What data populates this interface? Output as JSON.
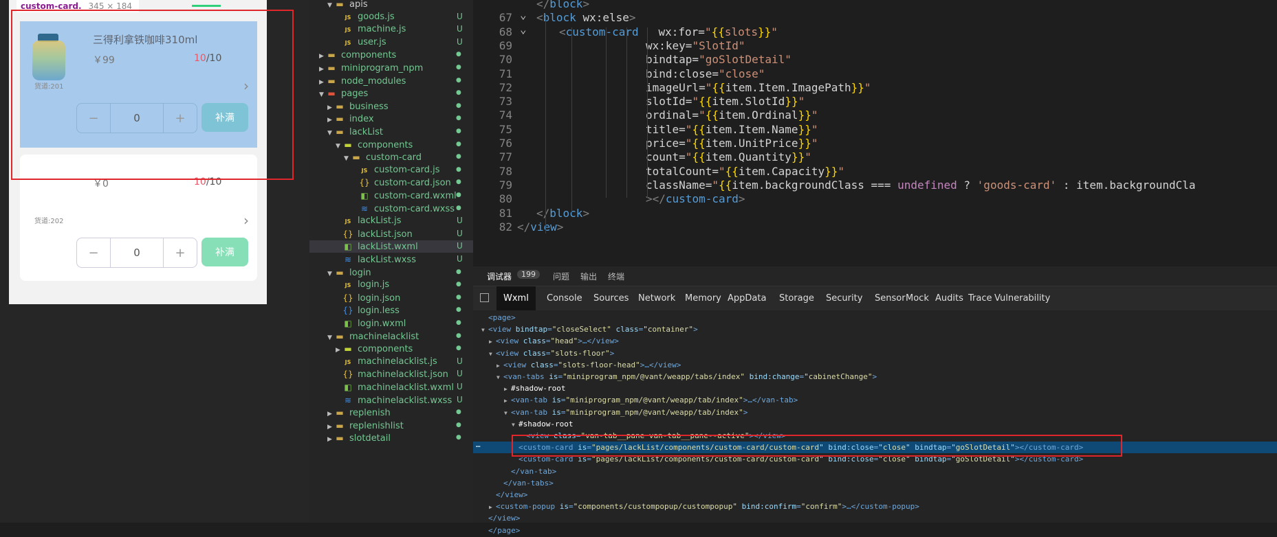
{
  "simulator": {
    "tooltip": {
      "name": "custom-card.",
      "size": "345 × 184"
    },
    "cards": [
      {
        "title": "三得利拿铁咖啡310ml",
        "price": "￥99",
        "count_current": "10",
        "count_total": "/10",
        "slot": "货道:201",
        "qty": "0",
        "minus": "−",
        "plus": "+",
        "fill": "补满"
      },
      {
        "title": "",
        "price": "￥0",
        "count_current": "10",
        "count_total": "/10",
        "slot": "货道:202",
        "qty": "0",
        "minus": "−",
        "plus": "+",
        "fill": "补满"
      }
    ]
  },
  "tree": [
    {
      "label": "apis",
      "icon": "folder",
      "indent": 1,
      "open": true,
      "status": ""
    },
    {
      "label": "goods.js",
      "icon": "js",
      "indent": 2,
      "status": "U"
    },
    {
      "label": "machine.js",
      "icon": "js",
      "indent": 2,
      "status": "U"
    },
    {
      "label": "user.js",
      "icon": "js",
      "indent": 2,
      "status": "U"
    },
    {
      "label": "components",
      "icon": "folder",
      "indent": 0,
      "open": false,
      "status": "dot"
    },
    {
      "label": "miniprogram_npm",
      "icon": "folder",
      "indent": 0,
      "open": false,
      "status": "dot"
    },
    {
      "label": "node_modules",
      "icon": "folder",
      "indent": 0,
      "open": false,
      "status": "dot"
    },
    {
      "label": "pages",
      "icon": "folder-red",
      "indent": 0,
      "open": true,
      "status": "dot"
    },
    {
      "label": "business",
      "icon": "folder",
      "indent": 1,
      "open": false,
      "status": "dot"
    },
    {
      "label": "index",
      "icon": "folder",
      "indent": 1,
      "open": false,
      "status": "dot"
    },
    {
      "label": "lackList",
      "icon": "folder",
      "indent": 1,
      "open": true,
      "status": "dot"
    },
    {
      "label": "components",
      "icon": "folder-green",
      "indent": 2,
      "open": true,
      "status": "dot"
    },
    {
      "label": "custom-card",
      "icon": "folder",
      "indent": 3,
      "open": true,
      "status": "dot"
    },
    {
      "label": "custom-card.js",
      "icon": "js",
      "indent": 4,
      "status": "dot"
    },
    {
      "label": "custom-card.json",
      "icon": "json",
      "indent": 4,
      "status": "dot"
    },
    {
      "label": "custom-card.wxml",
      "icon": "wxml",
      "indent": 4,
      "status": "dot"
    },
    {
      "label": "custom-card.wxss",
      "icon": "wxss",
      "indent": 4,
      "status": "dot"
    },
    {
      "label": "lackList.js",
      "icon": "js",
      "indent": 2,
      "status": "U"
    },
    {
      "label": "lackList.json",
      "icon": "json",
      "indent": 2,
      "status": "U"
    },
    {
      "label": "lackList.wxml",
      "icon": "wxml",
      "indent": 2,
      "status": "U",
      "selected": true
    },
    {
      "label": "lackList.wxss",
      "icon": "wxss",
      "indent": 2,
      "status": "U"
    },
    {
      "label": "login",
      "icon": "folder",
      "indent": 1,
      "open": true,
      "status": "dot"
    },
    {
      "label": "login.js",
      "icon": "js",
      "indent": 2,
      "status": "dot"
    },
    {
      "label": "login.json",
      "icon": "json",
      "indent": 2,
      "status": "dot"
    },
    {
      "label": "login.less",
      "icon": "less",
      "indent": 2,
      "status": "dot"
    },
    {
      "label": "login.wxml",
      "icon": "wxml",
      "indent": 2,
      "status": "dot"
    },
    {
      "label": "machinelacklist",
      "icon": "folder",
      "indent": 1,
      "open": true,
      "status": "dot"
    },
    {
      "label": "components",
      "icon": "folder-green",
      "indent": 2,
      "open": false,
      "status": "dot"
    },
    {
      "label": "machinelacklist.js",
      "icon": "js",
      "indent": 2,
      "status": "U"
    },
    {
      "label": "machinelacklist.json",
      "icon": "json",
      "indent": 2,
      "status": "U"
    },
    {
      "label": "machinelacklist.wxml",
      "icon": "wxml",
      "indent": 2,
      "status": "U"
    },
    {
      "label": "machinelacklist.wxss",
      "icon": "wxss",
      "indent": 2,
      "status": "U"
    },
    {
      "label": "replenish",
      "icon": "folder",
      "indent": 1,
      "open": false,
      "status": "dot"
    },
    {
      "label": "replenishlist",
      "icon": "folder",
      "indent": 1,
      "open": false,
      "status": "dot"
    },
    {
      "label": "slotdetail",
      "icon": "folder",
      "indent": 1,
      "open": false,
      "status": "dot"
    }
  ],
  "editor": {
    "lines": [
      {
        "n": "",
        "indent": 2,
        "tokens": [
          [
            "p",
            "</"
          ],
          [
            "t",
            "block"
          ],
          [
            "p",
            ">"
          ]
        ]
      },
      {
        "n": "67",
        "indent": 2,
        "tokens": [
          [
            "p",
            "<"
          ],
          [
            "t",
            "block"
          ],
          [
            "w",
            " wx:else"
          ],
          [
            "p",
            ">"
          ]
        ]
      },
      {
        "n": "68",
        "indent": 3,
        "tokens": [
          [
            "p",
            "<"
          ],
          [
            "t",
            "custom-card"
          ],
          [
            "w",
            "   wx:for="
          ],
          [
            "s",
            "\""
          ],
          [
            "b",
            "{{"
          ],
          [
            "s",
            "slots"
          ],
          [
            "b",
            "}}"
          ],
          [
            "s",
            "\""
          ]
        ]
      },
      {
        "n": "69",
        "indent": 6,
        "tokens": [
          [
            "w",
            "wx:key="
          ],
          [
            "s",
            "\"SlotId\""
          ]
        ]
      },
      {
        "n": "70",
        "indent": 6,
        "tokens": [
          [
            "w",
            "bindtap="
          ],
          [
            "s",
            "\"goSlotDetail\""
          ]
        ]
      },
      {
        "n": "71",
        "indent": 6,
        "tokens": [
          [
            "w",
            "bind:close="
          ],
          [
            "s",
            "\"close\""
          ]
        ]
      },
      {
        "n": "72",
        "indent": 6,
        "tokens": [
          [
            "w",
            "imageUrl="
          ],
          [
            "s",
            "\""
          ],
          [
            "b",
            "{{"
          ],
          [
            "w",
            "item.Item.ImagePath"
          ],
          [
            "b",
            "}}"
          ],
          [
            "s",
            "\""
          ]
        ]
      },
      {
        "n": "73",
        "indent": 6,
        "tokens": [
          [
            "w",
            "slotId="
          ],
          [
            "s",
            "\""
          ],
          [
            "b",
            "{{"
          ],
          [
            "w",
            "item.SlotId"
          ],
          [
            "b",
            "}}"
          ],
          [
            "s",
            "\""
          ]
        ]
      },
      {
        "n": "74",
        "indent": 6,
        "tokens": [
          [
            "w",
            "ordinal="
          ],
          [
            "s",
            "\""
          ],
          [
            "b",
            "{{"
          ],
          [
            "w",
            "item.Ordinal"
          ],
          [
            "b",
            "}}"
          ],
          [
            "s",
            "\""
          ]
        ]
      },
      {
        "n": "75",
        "indent": 6,
        "tokens": [
          [
            "w",
            "title="
          ],
          [
            "s",
            "\""
          ],
          [
            "b",
            "{{"
          ],
          [
            "w",
            "item.Item.Name"
          ],
          [
            "b",
            "}}"
          ],
          [
            "s",
            "\""
          ]
        ]
      },
      {
        "n": "76",
        "indent": 6,
        "tokens": [
          [
            "w",
            "price="
          ],
          [
            "s",
            "\""
          ],
          [
            "b",
            "{{"
          ],
          [
            "w",
            "item.UnitPrice"
          ],
          [
            "b",
            "}}"
          ],
          [
            "s",
            "\""
          ]
        ]
      },
      {
        "n": "77",
        "indent": 6,
        "tokens": [
          [
            "w",
            "count="
          ],
          [
            "s",
            "\""
          ],
          [
            "b",
            "{{"
          ],
          [
            "w",
            "item.Quantity"
          ],
          [
            "b",
            "}}"
          ],
          [
            "s",
            "\""
          ]
        ]
      },
      {
        "n": "78",
        "indent": 6,
        "tokens": [
          [
            "w",
            "totalCount="
          ],
          [
            "s",
            "\""
          ],
          [
            "b",
            "{{"
          ],
          [
            "w",
            "item.Capacity"
          ],
          [
            "b",
            "}}"
          ],
          [
            "s",
            "\""
          ]
        ]
      },
      {
        "n": "79",
        "indent": 6,
        "tokens": [
          [
            "w",
            "className="
          ],
          [
            "s",
            "\""
          ],
          [
            "b",
            "{{"
          ],
          [
            "w",
            "item.backgroundClass === "
          ],
          [
            "k",
            "undefined"
          ],
          [
            "w",
            " ? "
          ],
          [
            "s",
            "'goods-card'"
          ],
          [
            "w",
            " : item.backgroundCla"
          ]
        ]
      },
      {
        "n": "80",
        "indent": 6,
        "tokens": [
          [
            "p",
            "></"
          ],
          [
            "t",
            "custom-card"
          ],
          [
            "p",
            ">"
          ]
        ]
      },
      {
        "n": "81",
        "indent": 2,
        "tokens": [
          [
            "p",
            "</"
          ],
          [
            "t",
            "block"
          ],
          [
            "p",
            ">"
          ]
        ]
      },
      {
        "n": "82",
        "indent": 1,
        "tokens": [
          [
            "p",
            "</"
          ],
          [
            "t",
            "view"
          ],
          [
            "p",
            ">"
          ]
        ]
      }
    ]
  },
  "debugger": {
    "top_tabs": [
      {
        "label": "调试器",
        "badge": "199"
      },
      {
        "label": "问题"
      },
      {
        "label": "输出"
      },
      {
        "label": "终端"
      }
    ],
    "tabs": [
      "Wxml",
      "Console",
      "Sources",
      "Network",
      "Memory",
      "AppData",
      "Storage",
      "Security",
      "Sensor",
      "Mock",
      "Audits",
      "Trace",
      "Vulnerability"
    ],
    "active_tab": "Wxml",
    "dom": [
      {
        "indent": 0,
        "arrow": "",
        "tokens": [
          [
            "tag",
            "<page>"
          ]
        ]
      },
      {
        "indent": 0,
        "arrow": "▼",
        "tokens": [
          [
            "tag",
            "<view "
          ],
          [
            "an",
            "bindtap"
          ],
          [
            "tag",
            "="
          ],
          [
            "av",
            "\"closeSelect\""
          ],
          [
            "an",
            " class"
          ],
          [
            "tag",
            "="
          ],
          [
            "av",
            "\"container\""
          ],
          [
            "tag",
            ">"
          ]
        ]
      },
      {
        "indent": 1,
        "arrow": "▶",
        "tokens": [
          [
            "tag",
            "<view "
          ],
          [
            "an",
            "class"
          ],
          [
            "tag",
            "="
          ],
          [
            "av",
            "\"head\""
          ],
          [
            "tag",
            ">…</view>"
          ]
        ]
      },
      {
        "indent": 1,
        "arrow": "▼",
        "tokens": [
          [
            "tag",
            "<view "
          ],
          [
            "an",
            "class"
          ],
          [
            "tag",
            "="
          ],
          [
            "av",
            "\"slots-floor\""
          ],
          [
            "tag",
            ">"
          ]
        ]
      },
      {
        "indent": 2,
        "arrow": "▶",
        "tokens": [
          [
            "tag",
            "<view "
          ],
          [
            "an",
            "class"
          ],
          [
            "tag",
            "="
          ],
          [
            "av",
            "\"slots-floor-head\""
          ],
          [
            "tag",
            ">…</view>"
          ]
        ]
      },
      {
        "indent": 2,
        "arrow": "▼",
        "tokens": [
          [
            "tag",
            "<van-tabs "
          ],
          [
            "an",
            "is"
          ],
          [
            "tag",
            "="
          ],
          [
            "av",
            "\"miniprogram_npm/@vant/weapp/tabs/index\""
          ],
          [
            "an",
            " bind:change"
          ],
          [
            "tag",
            "="
          ],
          [
            "av",
            "\"cabinetChange\""
          ],
          [
            "tag",
            ">"
          ]
        ]
      },
      {
        "indent": 3,
        "arrow": "▶",
        "tokens": [
          [
            "w",
            "#shadow-root"
          ]
        ]
      },
      {
        "indent": 3,
        "arrow": "▶",
        "tokens": [
          [
            "tag",
            "<van-tab "
          ],
          [
            "an",
            "is"
          ],
          [
            "tag",
            "="
          ],
          [
            "av",
            "\"miniprogram_npm/@vant/weapp/tab/index\""
          ],
          [
            "tag",
            ">…</van-tab>"
          ]
        ]
      },
      {
        "indent": 3,
        "arrow": "▼",
        "tokens": [
          [
            "tag",
            "<van-tab "
          ],
          [
            "an",
            "is"
          ],
          [
            "tag",
            "="
          ],
          [
            "av",
            "\"miniprogram_npm/@vant/weapp/tab/index\""
          ],
          [
            "tag",
            ">"
          ]
        ]
      },
      {
        "indent": 4,
        "arrow": "▼",
        "tokens": [
          [
            "w",
            "#shadow-root"
          ]
        ]
      },
      {
        "indent": 5,
        "arrow": "",
        "tokens": [
          [
            "tag",
            "<view "
          ],
          [
            "an",
            "class"
          ],
          [
            "tag",
            "="
          ],
          [
            "av",
            "\"van-tab__pane van-tab__pane--active\""
          ],
          [
            "tag",
            "></view>"
          ]
        ]
      },
      {
        "indent": 4,
        "arrow": "",
        "selected": true,
        "tokens": [
          [
            "tag",
            "<custom-card "
          ],
          [
            "an",
            "is"
          ],
          [
            "tag",
            "="
          ],
          [
            "av",
            "\"pages/lackList/components/custom-card/custom-card\""
          ],
          [
            "an",
            " bind:close"
          ],
          [
            "tag",
            "="
          ],
          [
            "av",
            "\"close\""
          ],
          [
            "an",
            " bindtap"
          ],
          [
            "tag",
            "="
          ],
          [
            "av",
            "\"goSlotDetail\""
          ],
          [
            "tag",
            "></custom-card>"
          ]
        ]
      },
      {
        "indent": 4,
        "arrow": "",
        "tokens": [
          [
            "tag",
            "<custom-card "
          ],
          [
            "an",
            "is"
          ],
          [
            "tag",
            "="
          ],
          [
            "av",
            "\"pages/lackList/components/custom-card/custom-card\""
          ],
          [
            "an",
            " bind:close"
          ],
          [
            "tag",
            "="
          ],
          [
            "av",
            "\"close\""
          ],
          [
            "an",
            " bindtap"
          ],
          [
            "tag",
            "="
          ],
          [
            "av",
            "\"goSlotDetail\""
          ],
          [
            "tag",
            "></custom-card>"
          ]
        ]
      },
      {
        "indent": 3,
        "arrow": "",
        "tokens": [
          [
            "tag",
            "</van-tab>"
          ]
        ]
      },
      {
        "indent": 2,
        "arrow": "",
        "tokens": [
          [
            "tag",
            "</van-tabs>"
          ]
        ]
      },
      {
        "indent": 1,
        "arrow": "",
        "tokens": [
          [
            "tag",
            "</view>"
          ]
        ]
      },
      {
        "indent": 1,
        "arrow": "▶",
        "tokens": [
          [
            "tag",
            "<custom-popup "
          ],
          [
            "an",
            "is"
          ],
          [
            "tag",
            "="
          ],
          [
            "av",
            "\"components/custompopup/custompopup\""
          ],
          [
            "an",
            " bind:confirm"
          ],
          [
            "tag",
            "="
          ],
          [
            "av",
            "\"confirm\""
          ],
          [
            "tag",
            ">…</custom-popup>"
          ]
        ]
      },
      {
        "indent": 0,
        "arrow": "",
        "tokens": [
          [
            "tag",
            "</view>"
          ]
        ]
      },
      {
        "indent": 0,
        "arrow": "",
        "tokens": [
          [
            "tag",
            "</page>"
          ]
        ]
      }
    ],
    "selected_marker": "…"
  },
  "colors": {
    "highlight_red": "#e0262b",
    "selection_blue": "#0e4a75",
    "git_untracked": "#73c991"
  }
}
